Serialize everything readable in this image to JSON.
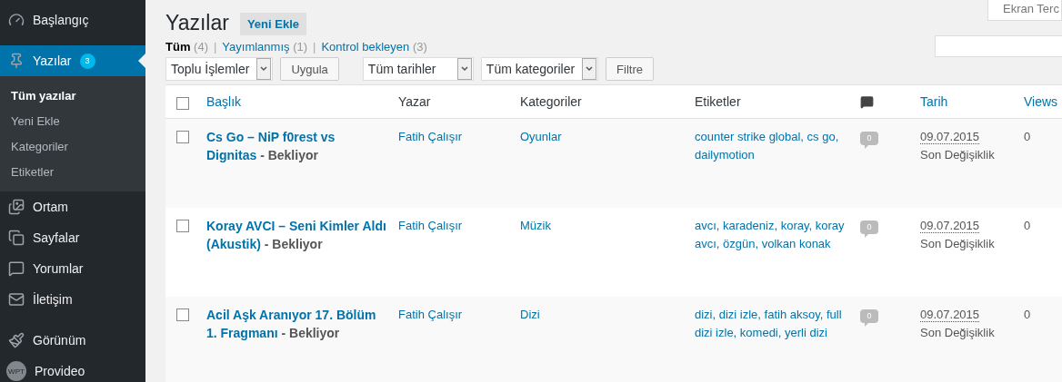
{
  "sidebar": {
    "groups": [
      [
        {
          "label": "Başlangıç",
          "selected": false
        }
      ],
      [
        {
          "label": "Yazılar",
          "selected": true,
          "badge": "3",
          "children": [
            {
              "label": "Tüm yazılar",
              "selected": true
            },
            {
              "label": "Yeni Ekle",
              "selected": false
            },
            {
              "label": "Kategoriler",
              "selected": false
            },
            {
              "label": "Etiketler",
              "selected": false
            }
          ]
        },
        {
          "label": "Ortam",
          "selected": false
        },
        {
          "label": "Sayfalar",
          "selected": false
        },
        {
          "label": "Yorumlar",
          "selected": false
        },
        {
          "label": "İletişim",
          "selected": false
        }
      ],
      [
        {
          "label": "Görünüm",
          "selected": false
        },
        {
          "label": "Provideo",
          "selected": false,
          "logo_text": "WPT"
        }
      ]
    ]
  },
  "header": {
    "title": "Yazılar",
    "add_button": "Yeni Ekle",
    "screen_options": "Ekran Terc"
  },
  "status_links": [
    {
      "label": "Tüm",
      "count": "(4)",
      "selected": true
    },
    {
      "label": "Yayımlanmış",
      "count": "(1)",
      "selected": false
    },
    {
      "label": "Kontrol bekleyen",
      "count": "(3)",
      "selected": false
    }
  ],
  "separator": "|",
  "toolbar": {
    "bulk_select": "Toplu İşlemler",
    "apply_button": "Uygula",
    "date_select": "Tüm tarihler",
    "category_select": "Tüm kategoriler",
    "filter_button": "Filtre"
  },
  "table": {
    "select_all_checked": false,
    "columns": [
      {
        "label": "Başlık",
        "sortable": true
      },
      {
        "label": "Yazar",
        "sortable": false
      },
      {
        "label": "Kategoriler",
        "sortable": false
      },
      {
        "label": "Etiketler",
        "sortable": false
      },
      {
        "kind": "comments"
      },
      {
        "label": "Tarih",
        "sortable": true
      },
      {
        "label": "Views",
        "sortable": true
      }
    ],
    "rows": [
      {
        "checked": false,
        "title": "Cs Go – NiP f0rest vs Dignitas",
        "state": "- Bekliyor",
        "author": "Fatih Çalışır",
        "category": "Oyunlar",
        "tags": "counter strike global, cs go, dailymotion",
        "comments": "0",
        "date": "09.07.2015",
        "date_note": "Son Değişiklik",
        "views": "0"
      },
      {
        "checked": false,
        "title": "Koray AVCI – Seni Kimler Aldı (Akustik)",
        "state": "- Bekliyor",
        "author": "Fatih Çalışır",
        "category": "Müzik",
        "tags": "avcı, karadeniz, koray, koray avcı, özgün, volkan konak",
        "comments": "0",
        "date": "09.07.2015",
        "date_note": "Son Değişiklik",
        "views": "0"
      },
      {
        "checked": false,
        "title": "Acil Aşk Aranıyor 17. Bölüm 1. Fragmanı",
        "state": "- Bekliyor",
        "author": "Fatih Çalışır",
        "category": "Dizi",
        "tags": "dizi, dizi izle, fatih aksoy, full dizi izle, komedi, yerli dizi",
        "comments": "0",
        "date": "09.07.2015",
        "date_note": "Son Değişiklik",
        "views": "0"
      }
    ]
  }
}
